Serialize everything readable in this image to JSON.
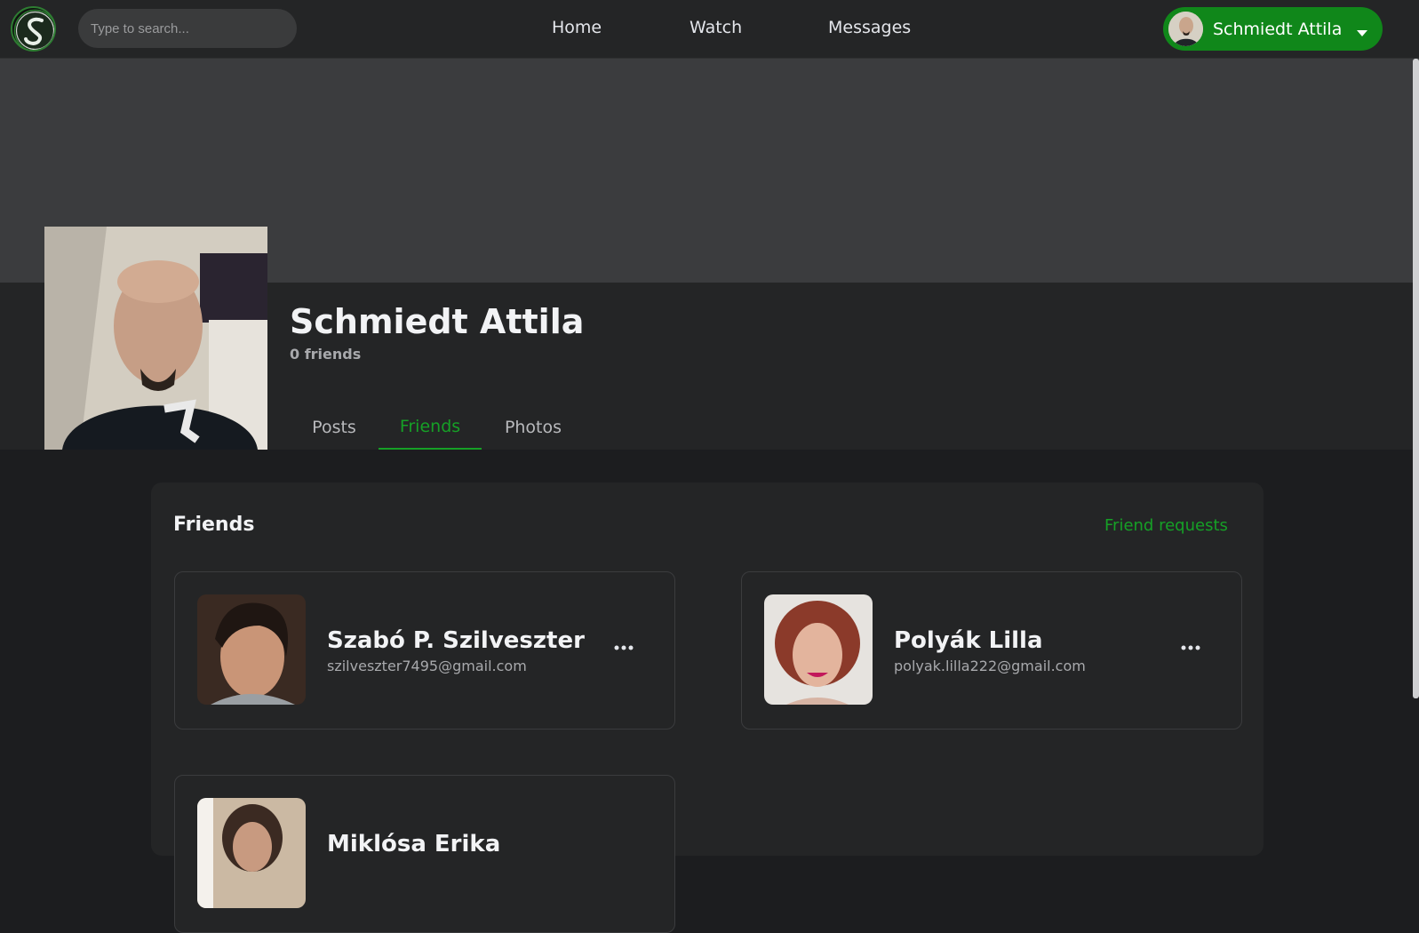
{
  "header": {
    "search_placeholder": "Type to search...",
    "nav": [
      "Home",
      "Watch",
      "Messages"
    ],
    "user_name": "Schmiedt Attila"
  },
  "profile": {
    "name": "Schmiedt Attila",
    "friend_count": "0 friends",
    "tabs": [
      "Posts",
      "Friends",
      "Photos"
    ],
    "active_tab": "Friends"
  },
  "friends_section": {
    "title": "Friends",
    "requests_link": "Friend requests",
    "items": [
      {
        "name": "Szabó P. Szilveszter",
        "email": "szilveszter7495@gmail.com",
        "menu": "•••"
      },
      {
        "name": "Polyák Lilla",
        "email": "polyak.lilla222@gmail.com",
        "menu": "•••"
      },
      {
        "name": "Miklósa Erika",
        "email": "",
        "menu": "•••"
      }
    ]
  },
  "colors": {
    "accent": "#16a026",
    "user_button": "#10871a",
    "background": "#1c1d1f",
    "panel": "#242526",
    "cover": "#3b3c3e"
  },
  "icons": {
    "logo": "social-logo-icon",
    "user_menu": "chevron-down-icon",
    "friend_menu": "more-options-icon"
  }
}
